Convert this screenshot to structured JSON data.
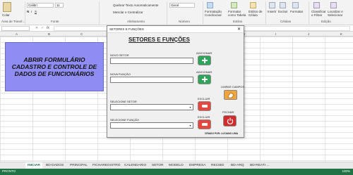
{
  "ribbon": {
    "font_name": "Calibri",
    "font_size": "11",
    "wrap_text": "Quebrar Texto Automaticamente",
    "merge_center": "Mesclar e Centralizar",
    "number_format": "Geral",
    "cond_format": "Formatação Condicional",
    "format_table": "Formatar como Tabela",
    "cell_styles": "Estilos de Célula",
    "insert": "Inserir",
    "delete": "Excluir",
    "format": "Formatar",
    "sort_filter": "Classificar e Filtrar",
    "find_select": "Localizar e Selecionar",
    "paste": "Colar",
    "groups": {
      "clipboard": "Área de Transf...",
      "font": "Fonte",
      "alignment": "Alinhamento",
      "number": "Número",
      "styles": "Estilos",
      "cells": "Células",
      "editing": "Edição"
    }
  },
  "formula_bar": {
    "name_box": "",
    "fx": "fx",
    "cancel": "✕",
    "enter": "✓"
  },
  "columns": [
    "A",
    "B",
    "C",
    "D",
    "E",
    "F",
    "G",
    "H",
    "I",
    "J",
    "K"
  ],
  "banner": {
    "text": "ABRIR FORMULÁRIO CADASTRO E CONTROLE DE DADOS DE FUNCIONÁRIOS"
  },
  "dialog": {
    "title": "SETORES E FUNÇÕES",
    "close": "✕",
    "heading": "SETORES E FUNÇÕES",
    "new_sector_label": "NOVO SETOR",
    "new_function_label": "NOVA FUNÇÃO",
    "select_sector_label": "SELECIONE SETOR",
    "select_function_label": "SELECIONE FUNÇÃO",
    "add_label_1": "ADICIONAR",
    "add_label_2": "ADICIONAR",
    "delete_label_1": "EXCLUIR",
    "delete_label_2": "EXCLUIR",
    "clear_label": "LIMPAR CAMPOS",
    "close_label": "FECHAR",
    "credit": "CRIADO POR: LUCIANO LIMA"
  },
  "tabs": [
    "INICIAR",
    "BD-DADOS",
    "PRINCIPAL",
    "FICHAREGISTRO",
    "CALENDARIO",
    "SETOR",
    "MODELO",
    "EMPRESA",
    "RECIBO",
    "BD-ARQ",
    "BD-REATI ..."
  ],
  "active_tab": "INICIAR",
  "status": {
    "left": "PRONTO",
    "zoom": "100%"
  },
  "colors": {
    "banner": "#8f8cf4",
    "add": "#2fa55c",
    "delete": "#e8453c",
    "clear": "#f2a33a",
    "power": "#d12b2b",
    "status_bar": "#217346"
  }
}
